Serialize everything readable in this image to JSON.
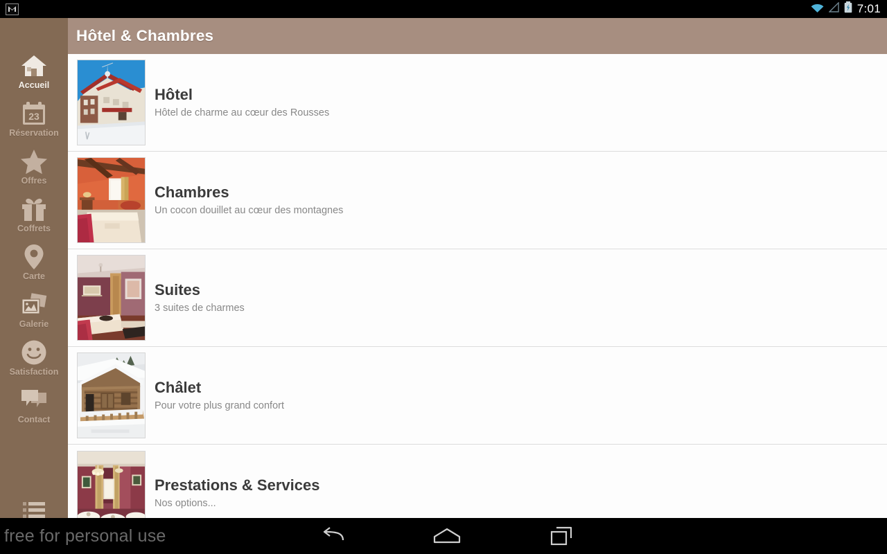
{
  "status_bar": {
    "notification_icon": "gmail-icon",
    "wifi_icon": "wifi-icon",
    "signal_icon": "signal-triangle-icon",
    "battery_icon": "battery-charging-icon",
    "clock": "7:01"
  },
  "sidebar": {
    "background_color": "#836a54",
    "items": [
      {
        "label": "Accueil",
        "icon": "home-icon",
        "active": true
      },
      {
        "label": "Réservation",
        "icon": "calendar-icon",
        "active": false,
        "badge": "23"
      },
      {
        "label": "Offres",
        "icon": "star-icon",
        "active": false
      },
      {
        "label": "Coffrets",
        "icon": "gift-icon",
        "active": false
      },
      {
        "label": "Carte",
        "icon": "map-pin-icon",
        "active": false
      },
      {
        "label": "Galerie",
        "icon": "photos-icon",
        "active": false
      },
      {
        "label": "Satisfaction",
        "icon": "smiley-icon",
        "active": false
      },
      {
        "label": "Contact",
        "icon": "chat-bubbles-icon",
        "active": false
      }
    ],
    "overflow_icon": "list-menu-icon"
  },
  "header": {
    "title": "Hôtel & Chambres",
    "background_color": "#a78e80",
    "text_color": "#ffffff"
  },
  "list": {
    "items": [
      {
        "title": "Hôtel",
        "subtitle": "Hôtel de charme au cœur des Rousses",
        "thumbnail": "hotel-exterior-snow-photo"
      },
      {
        "title": "Chambres",
        "subtitle": "Un cocon douillet au cœur des montagnes",
        "thumbnail": "bedroom-orange-walls-photo"
      },
      {
        "title": "Suites",
        "subtitle": "3 suites de charmes",
        "thumbnail": "suite-mauve-room-photo"
      },
      {
        "title": "Châlet",
        "subtitle": "Pour votre plus grand confort",
        "thumbnail": "wooden-chalet-snow-photo"
      },
      {
        "title": "Prestations & Services",
        "subtitle": "Nos options...",
        "thumbnail": "dining-room-chandelier-photo"
      }
    ]
  },
  "system_nav": {
    "watermark": "free for personal use",
    "buttons": [
      {
        "name": "back-button",
        "icon": "back-arrow-icon"
      },
      {
        "name": "home-button",
        "icon": "home-outline-icon"
      },
      {
        "name": "recents-button",
        "icon": "recents-squares-icon"
      }
    ]
  }
}
